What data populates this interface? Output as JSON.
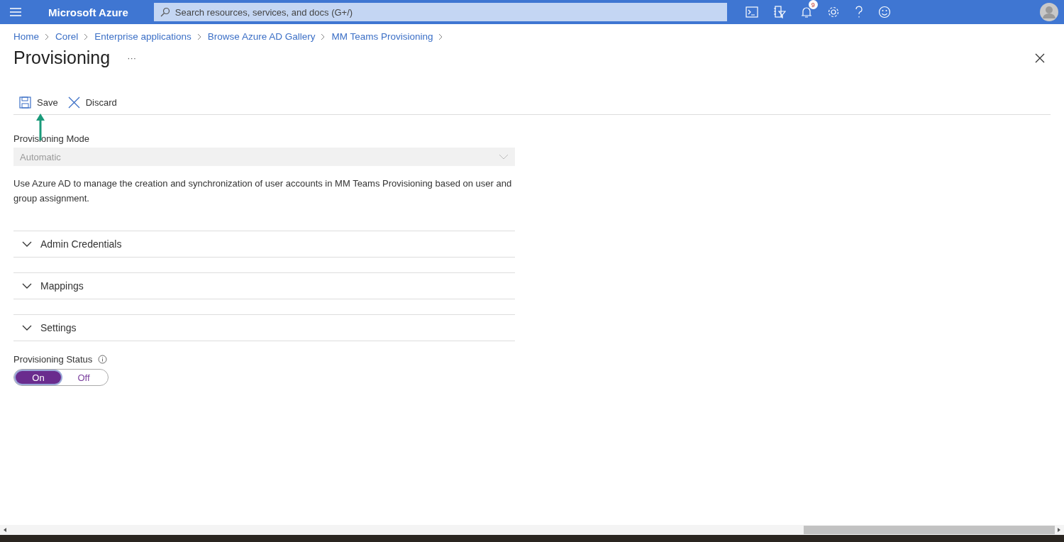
{
  "topbar": {
    "brand": "Microsoft Azure",
    "search": {
      "placeholder": "Search resources, services, and docs (G+/)"
    },
    "notification_count": "9"
  },
  "breadcrumbs": [
    "Home",
    "Corel",
    "Enterprise applications",
    "Browse Azure AD Gallery",
    "MM Teams Provisioning"
  ],
  "page": {
    "title": "Provisioning",
    "more": "···"
  },
  "toolbar": [
    {
      "kind": "save",
      "label": "Save"
    },
    {
      "kind": "discard",
      "label": "Discard"
    }
  ],
  "mode": {
    "label": "Provisioning Mode",
    "value": "Automatic",
    "disabled": true
  },
  "description": "Use Azure AD to manage the creation and synchronization of user accounts in MM Teams Provisioning based on user and group assignment.",
  "sections": [
    {
      "title": "Admin Credentials"
    },
    {
      "title": "Mappings"
    },
    {
      "title": "Settings"
    }
  ],
  "status": {
    "label": "Provisioning Status",
    "options": [
      {
        "label": "On",
        "selected": true
      },
      {
        "label": "Off",
        "selected": false
      }
    ]
  }
}
